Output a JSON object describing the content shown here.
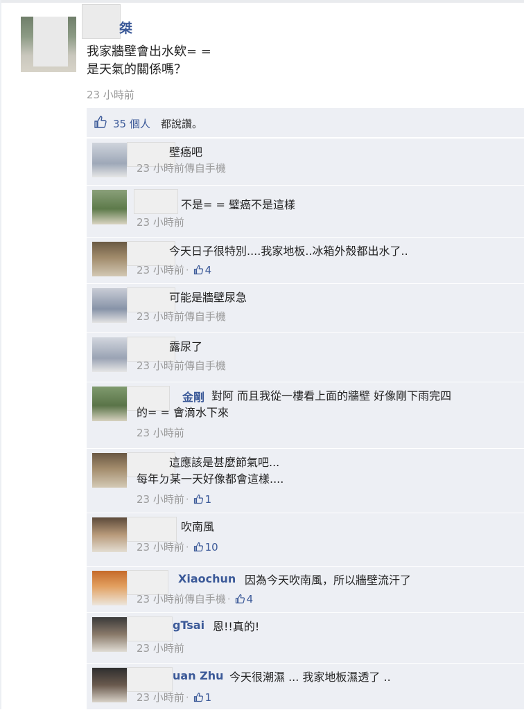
{
  "post": {
    "author": "桀",
    "body": [
      "我家牆壁會出水欸= =",
      "是天氣的關係嗎？"
    ],
    "time": "23 小時前",
    "likes_count": "35 個人",
    "likes_suffix": "都說讚。"
  },
  "comments": [
    {
      "name": "",
      "text": [
        "壁癌吧"
      ],
      "meta": "23 小時前傳自手機",
      "likes": null
    },
    {
      "name": "",
      "text": [
        "不是= = 璧癌不是這樣"
      ],
      "meta": "23 小時前",
      "likes": null
    },
    {
      "name": "",
      "text": [
        "今天日子很特別....我家地板..冰箱外殼都出水了.."
      ],
      "meta": "23 小時前",
      "likes": "4"
    },
    {
      "name": "",
      "text": [
        "可能是牆壁尿急"
      ],
      "meta": "23 小時前傳自手機",
      "likes": null
    },
    {
      "name": "",
      "text": [
        "露尿了"
      ],
      "meta": "23 小時前傳自手機",
      "likes": null
    },
    {
      "name": "金剛",
      "text": [
        "對阿 而且我從一樓看上面的牆壁 好像剛下雨完四",
        "的= = 會滴水下來"
      ],
      "meta": "23 小時前",
      "likes": null
    },
    {
      "name": "",
      "text": [
        "這應該是甚麼節氣吧...",
        "每年ㄉ某一天好像都會這樣...."
      ],
      "meta": "23 小時前",
      "likes": "1"
    },
    {
      "name": "",
      "text": [
        "吹南風"
      ],
      "meta": "23 小時前",
      "likes": "10"
    },
    {
      "name": "Xiaochun",
      "text": [
        "因為今天吹南風，所以牆壁流汗了"
      ],
      "meta": "23 小時前傳自手機",
      "likes": "4"
    },
    {
      "name": "gTsai",
      "text": [
        "恩!!真的!"
      ],
      "meta": "23 小時前",
      "likes": null
    },
    {
      "name": "uan Zhu",
      "text": [
        "今天很潮濕 ... 我家地板濕透了 .."
      ],
      "meta": "23 小時前",
      "likes": "1"
    }
  ],
  "colors": {
    "link": "#3b5998",
    "ufi_bg": "#edeff4",
    "meta": "#9b9b9b"
  }
}
